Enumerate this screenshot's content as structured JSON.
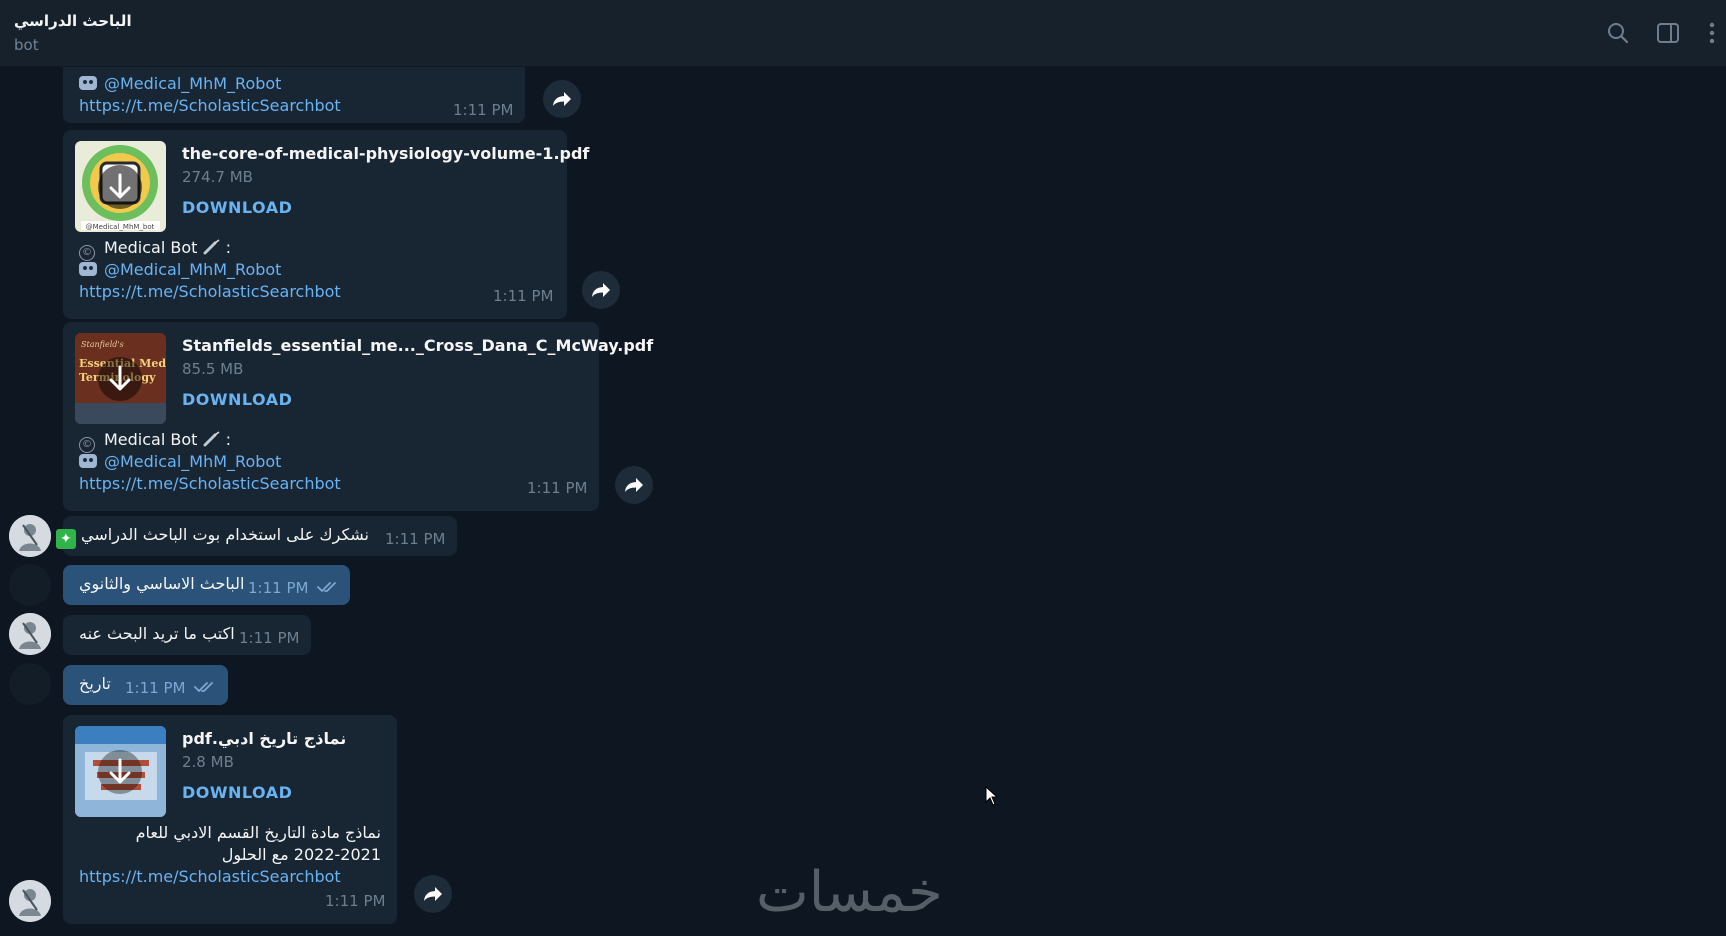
{
  "header": {
    "title": "الباحث الدراسي",
    "subtitle": "bot"
  },
  "messages": {
    "m1": {
      "mention": "@Medical_MhM_Robot",
      "link": "https://t.me/ScholasticSearchbot",
      "time": "1:11 PM"
    },
    "m2": {
      "file_name": "the-core-of-medical-physiology-volume-1.pdf",
      "file_size": "274.7 MB",
      "download": "DOWNLOAD",
      "caption_prefix": "Medical Bot",
      "caption_suffix": ":",
      "mention": "@Medical_MhM_Robot",
      "link": "https://t.me/ScholasticSearchbot",
      "time": "1:11 PM"
    },
    "m3": {
      "file_name": "Stanfields_essential_me..._Cross_Dana_C_McWay.pdf",
      "file_size": "85.5 MB",
      "download": "DOWNLOAD",
      "thumb_title": "Stanfield's Essential Medical Terminology",
      "caption_prefix": "Medical Bot",
      "caption_suffix": ":",
      "mention": "@Medical_MhM_Robot",
      "link": "https://t.me/ScholasticSearchbot",
      "time": "1:11 PM"
    },
    "m4": {
      "text": "نشكرك على استخدام بوت الباحث الدراسي",
      "time": "1:11 PM"
    },
    "m5": {
      "text": "الباحث الاساسي والثانوي",
      "time": "1:11 PM"
    },
    "m6": {
      "text": "اكتب ما تريد البحث عنه",
      "time": "1:11 PM"
    },
    "m7": {
      "text": "تاريخ",
      "time": "1:11 PM"
    },
    "m8": {
      "file_name": "نماذج تاريخ ادبي.pdf",
      "file_size": "2.8 MB",
      "download": "DOWNLOAD",
      "caption_line1": "نماذج مادة التاريخ القسم الادبي للعام",
      "caption_line2": "2022-2021 مع الحلول",
      "link": "https://t.me/ScholasticSearchbot",
      "time": "1:11 PM"
    }
  },
  "watermark": "خمسات",
  "colors": {
    "background": "#0e1621",
    "header": "#17212b",
    "incoming_bubble": "#182533",
    "outgoing_bubble": "#2b5278",
    "link": "#6ab3f3"
  },
  "icons": [
    "search-icon",
    "sidebar-toggle-icon",
    "more-vertical-icon",
    "forward-icon",
    "robot-emoji",
    "copyright-emoji",
    "syringe-emoji",
    "sparkle-emoji",
    "double-check-icon",
    "download-arrow-icon"
  ]
}
